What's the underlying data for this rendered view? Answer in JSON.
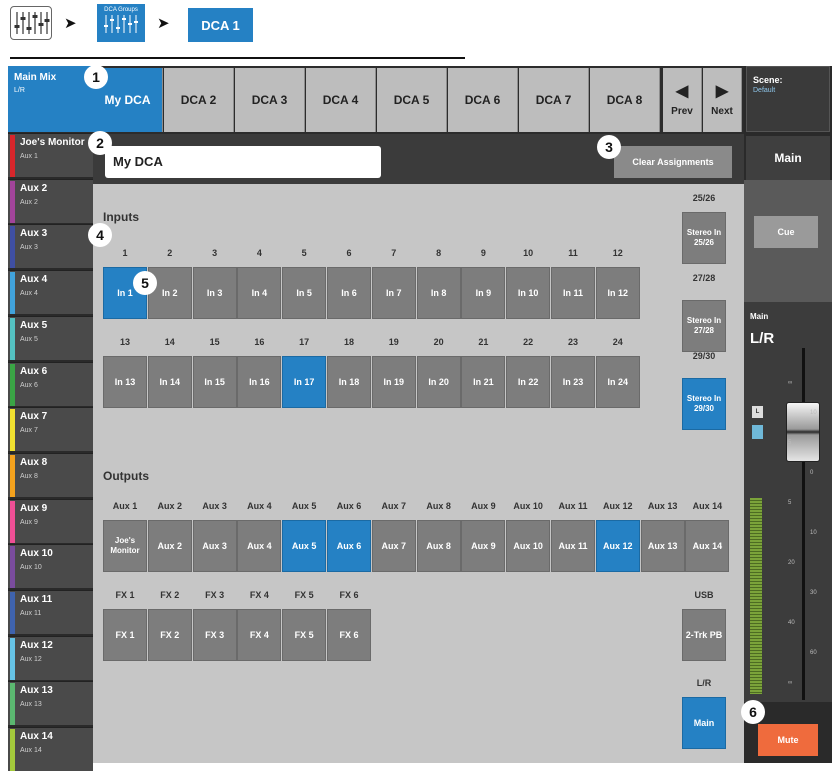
{
  "breadcrumb": {
    "dca_groups_label": "DCA Groups",
    "active": "DCA 1"
  },
  "tabs": [
    "My DCA",
    "DCA 2",
    "DCA 3",
    "DCA 4",
    "DCA 5",
    "DCA 6",
    "DCA 7",
    "DCA 8"
  ],
  "nav": {
    "prev": "Prev",
    "next": "Next"
  },
  "sidebar": {
    "main": {
      "title": "Main Mix",
      "sub": "L/R"
    },
    "items": [
      {
        "title": "Joe's Monitor",
        "sub": "Aux 1",
        "color": "#d8262b"
      },
      {
        "title": "Aux 2",
        "sub": "Aux 2",
        "color": "#a2449a"
      },
      {
        "title": "Aux 3",
        "sub": "Aux 3",
        "color": "#3f4fa3"
      },
      {
        "title": "Aux 4",
        "sub": "Aux 4",
        "color": "#41a3dc"
      },
      {
        "title": "Aux 5",
        "sub": "Aux 5",
        "color": "#54c1c1"
      },
      {
        "title": "Aux 6",
        "sub": "Aux 6",
        "color": "#3aa545"
      },
      {
        "title": "Aux 7",
        "sub": "Aux 7",
        "color": "#f0e030"
      },
      {
        "title": "Aux 8",
        "sub": "Aux 8",
        "color": "#f4a21d"
      },
      {
        "title": "Aux 9",
        "sub": "Aux 9",
        "color": "#ef4f95"
      },
      {
        "title": "Aux 10",
        "sub": "Aux 10",
        "color": "#7a4c9e"
      },
      {
        "title": "Aux 11",
        "sub": "Aux 11",
        "color": "#3f63ae"
      },
      {
        "title": "Aux 12",
        "sub": "Aux 12",
        "color": "#66c3e6"
      },
      {
        "title": "Aux 13",
        "sub": "Aux 13",
        "color": "#5bb870"
      },
      {
        "title": "Aux 14",
        "sub": "Aux 14",
        "color": "#a3c93b"
      }
    ]
  },
  "name_field": "My DCA",
  "clear_assignments": "Clear Assignments",
  "inputs": {
    "title": "Inputs",
    "row1_nums": [
      "1",
      "2",
      "3",
      "4",
      "5",
      "6",
      "7",
      "8",
      "9",
      "10",
      "11",
      "12"
    ],
    "row1": [
      {
        "label": "In 1",
        "on": true
      },
      {
        "label": "In 2",
        "on": false
      },
      {
        "label": "In 3",
        "on": false
      },
      {
        "label": "In 4",
        "on": false
      },
      {
        "label": "In 5",
        "on": false
      },
      {
        "label": "In 6",
        "on": false
      },
      {
        "label": "In 7",
        "on": false
      },
      {
        "label": "In 8",
        "on": false
      },
      {
        "label": "In 9",
        "on": false
      },
      {
        "label": "In 10",
        "on": false
      },
      {
        "label": "In 11",
        "on": false
      },
      {
        "label": "In 12",
        "on": false
      }
    ],
    "row2_nums": [
      "13",
      "14",
      "15",
      "16",
      "17",
      "18",
      "19",
      "20",
      "21",
      "22",
      "23",
      "24"
    ],
    "row2": [
      {
        "label": "In 13",
        "on": false
      },
      {
        "label": "In 14",
        "on": false
      },
      {
        "label": "In 15",
        "on": false
      },
      {
        "label": "In 16",
        "on": false
      },
      {
        "label": "In 17",
        "on": true
      },
      {
        "label": "In 18",
        "on": false
      },
      {
        "label": "In 19",
        "on": false
      },
      {
        "label": "In 20",
        "on": false
      },
      {
        "label": "In 21",
        "on": false
      },
      {
        "label": "In 22",
        "on": false
      },
      {
        "label": "In 23",
        "on": false
      },
      {
        "label": "In 24",
        "on": false
      }
    ],
    "stereo": [
      {
        "num": "25/26",
        "label": "Stereo In 25/26",
        "on": false
      },
      {
        "num": "27/28",
        "label": "Stereo In 27/28",
        "on": false
      },
      {
        "num": "29/30",
        "label": "Stereo In 29/30",
        "on": true
      }
    ]
  },
  "outputs": {
    "title": "Outputs",
    "aux_nums": [
      "Aux 1",
      "Aux 2",
      "Aux 3",
      "Aux 4",
      "Aux 5",
      "Aux 6",
      "Aux 7",
      "Aux 8",
      "Aux 9",
      "Aux 10",
      "Aux 11",
      "Aux 12",
      "Aux 13",
      "Aux 14"
    ],
    "aux": [
      {
        "label": "Joe's Monitor",
        "on": false
      },
      {
        "label": "Aux 2",
        "on": false
      },
      {
        "label": "Aux 3",
        "on": false
      },
      {
        "label": "Aux 4",
        "on": false
      },
      {
        "label": "Aux 5",
        "on": true
      },
      {
        "label": "Aux 6",
        "on": true
      },
      {
        "label": "Aux 7",
        "on": false
      },
      {
        "label": "Aux 8",
        "on": false
      },
      {
        "label": "Aux 9",
        "on": false
      },
      {
        "label": "Aux 10",
        "on": false
      },
      {
        "label": "Aux 11",
        "on": false
      },
      {
        "label": "Aux 12",
        "on": true
      },
      {
        "label": "Aux 13",
        "on": false
      },
      {
        "label": "Aux 14",
        "on": false
      }
    ],
    "fx_nums": [
      "FX 1",
      "FX 2",
      "FX 3",
      "FX 4",
      "FX 5",
      "FX 6"
    ],
    "fx": [
      {
        "label": "FX 1",
        "on": false
      },
      {
        "label": "FX 2",
        "on": false
      },
      {
        "label": "FX 3",
        "on": false
      },
      {
        "label": "FX 4",
        "on": false
      },
      {
        "label": "FX 5",
        "on": false
      },
      {
        "label": "FX 6",
        "on": false
      }
    ],
    "usb": {
      "num": "USB",
      "label": "2-Trk PB",
      "on": false
    },
    "lr": {
      "num": "L/R",
      "label": "Main",
      "on": true
    }
  },
  "right": {
    "scene_title": "Scene:",
    "scene_value": "Default",
    "main_tab": "Main",
    "cue": "Cue",
    "channel_small": "Main",
    "channel_big": "L/R",
    "meter_l": "L",
    "scale": [
      "∞",
      "10",
      "5",
      "0",
      "5",
      "10",
      "20",
      "30",
      "40",
      "60",
      "∞"
    ],
    "mute": "Mute"
  },
  "callouts": [
    "1",
    "2",
    "3",
    "4",
    "5",
    "6"
  ]
}
